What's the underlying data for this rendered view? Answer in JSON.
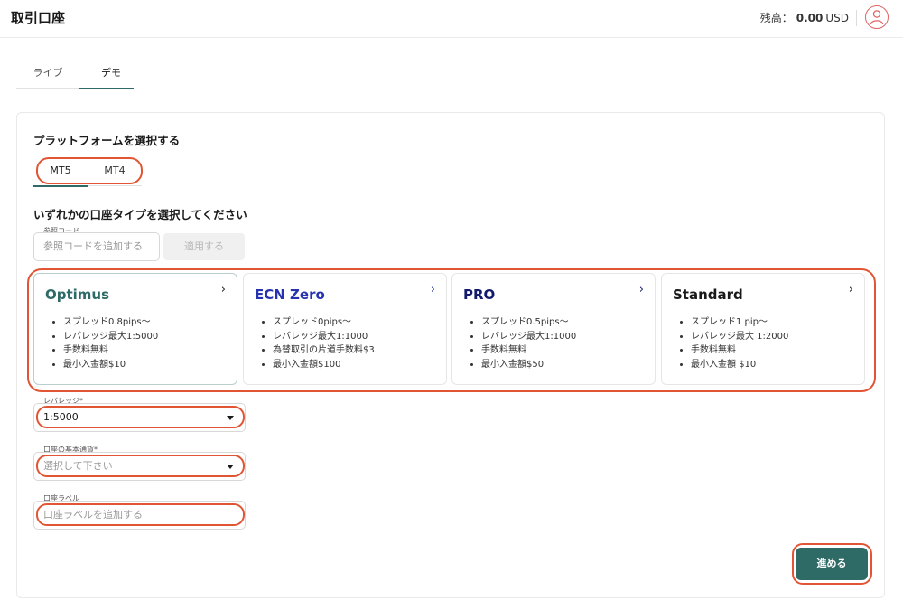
{
  "header": {
    "title": "取引口座",
    "balance_label": "残高：",
    "balance_amount": "0.00",
    "balance_currency": "USD",
    "avatar_icon": "user-icon"
  },
  "mode_tabs": [
    {
      "label": "ライブ",
      "active": false
    },
    {
      "label": "デモ",
      "active": true
    }
  ],
  "platform": {
    "heading": "プラットフォームを選択する",
    "tabs": [
      {
        "label": "MT5",
        "active": true
      },
      {
        "label": "MT4",
        "active": false
      }
    ]
  },
  "account_type": {
    "heading": "いずれかの口座タイプを選択してください",
    "referral": {
      "label": "参照コード",
      "placeholder": "参照コードを追加する",
      "apply_label": "適用する"
    },
    "cards": [
      {
        "name": "Optimus",
        "selected": true,
        "features": [
          "スプレッド0.8pips〜",
          "レバレッジ最大1:5000",
          "手数料無料",
          "最小入金額$10"
        ]
      },
      {
        "name": "ECN Zero",
        "selected": false,
        "features": [
          "スプレッド0pips〜",
          "レバレッジ最大1:1000",
          "為替取引の片道手数料$3",
          "最小入金額$100"
        ]
      },
      {
        "name": "PRO",
        "selected": false,
        "features": [
          "スプレッド0.5pips〜",
          "レバレッジ最大1:1000",
          "手数料無料",
          "最小入金額$50"
        ]
      },
      {
        "name": "Standard",
        "selected": false,
        "features": [
          "スプレッド1 pip〜",
          "レバレッジ最大 1:2000",
          "手数料無料",
          "最小入金額 $10"
        ]
      }
    ]
  },
  "form": {
    "leverage": {
      "label": "レバレッジ*",
      "value": "1:5000"
    },
    "base_currency": {
      "label": "口座の基本通貨*",
      "placeholder": "選択して下さい"
    },
    "account_label": {
      "label": "口座ラベル",
      "placeholder": "口座ラベルを追加する"
    }
  },
  "actions": {
    "proceed_label": "進める"
  },
  "colors": {
    "accent": "#2e6b67",
    "highlight": "#e15535"
  }
}
